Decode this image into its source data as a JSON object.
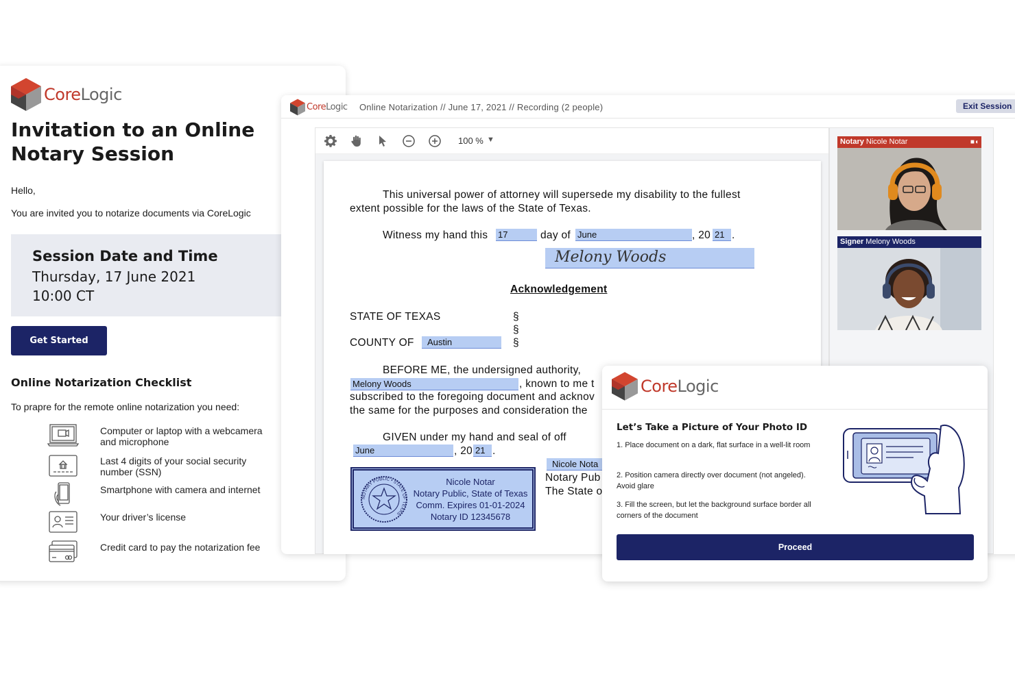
{
  "brand": {
    "name_core": "Core",
    "name_logic": "Logic",
    "trademark": "®",
    "colors": {
      "red": "#c0392b",
      "navy": "#1c2466",
      "highlight": "#b7cdf3"
    }
  },
  "email": {
    "title": "Invitation to an Online Notary Session",
    "greeting": "Hello,",
    "intro": "You are invited you to notarize documents via CoreLogic",
    "session_heading": "Session Date and Time",
    "session_date": "Thursday, 17 June 2021",
    "session_time": "10:00 CT",
    "get_started_label": "Get Started",
    "checklist_heading": "Online Notarization Checklist",
    "checklist_intro": "To prapre for the remote online notarization you need:",
    "checklist": [
      {
        "icon": "computer-icon",
        "text": "Computer or laptop with a webcamera and microphone"
      },
      {
        "icon": "ssn-card-icon",
        "text": "Last 4 digits of your social security number (SSN)"
      },
      {
        "icon": "smartphone-icon",
        "text": "Smartphone with camera and internet"
      },
      {
        "icon": "drivers-license-icon",
        "text": "Your driver’s license"
      },
      {
        "icon": "credit-card-icon",
        "text": "Credit card to pay the notarization fee"
      }
    ]
  },
  "session": {
    "breadcrumb": "Online Notarization // June 17, 2021 // Recording (2 people)",
    "exit_label": "Exit Session",
    "toolbar": {
      "icons": [
        "gear-icon",
        "hand-pan-icon",
        "pointer-icon",
        "zoom-out-icon",
        "zoom-in-icon"
      ],
      "zoom": "100 %"
    },
    "document": {
      "para1_line1": "This universal power of attorney will supersede my disability to the fullest",
      "para1_line2": "extent possible for the laws of the State of Texas.",
      "witness_prefix": "Witness my hand this",
      "witness_day": "17",
      "witness_mid": "day of",
      "witness_month": "June",
      "witness_year_prefix": ", 20",
      "witness_year": "21",
      "witness_end": ".",
      "signature": "Melony Woods",
      "ack_heading": "Acknowledgement",
      "state_label": "STATE OF TEXAS",
      "county_label": "COUNTY OF",
      "county_value": "Austin",
      "section_mark": "§",
      "before_line": "BEFORE ME, the undersigned authority,",
      "signer_name": "Melony Woods",
      "known_to_me": ", known to me t",
      "subscribed_line": "subscribed to the foregoing document and acknov",
      "same_line": "the same for the purposes and consideration the",
      "given_line": "GIVEN   under   my   hand   and   seal   of   off",
      "given_month": "June",
      "given_year_prefix": ", 20",
      "given_year": "21",
      "given_end": ".",
      "notary_name_field": "Nicole Nota",
      "notary_pub_line": "Notary Pub",
      "state_of_line": "The State o",
      "seal": {
        "name": "Nicole Notar",
        "title": "Notary Public, State of Texas",
        "expires": "Comm. Expires 01-01-2024",
        "id": "Notary ID 12345678",
        "ring_text": "NOTARY PUBLIC • STATE OF TEXAS"
      }
    },
    "videos": [
      {
        "role": "Notary",
        "name": "Nicole Notar",
        "color": "#c0392b"
      },
      {
        "role": "Signer",
        "name": "Melony Woods",
        "color": "#1c2466"
      }
    ]
  },
  "modal": {
    "title": "Let’s Take a Picture of Your Photo ID",
    "steps": [
      "1. Place document on a dark, flat surface in a well-lit room",
      "2. Position camera directly over document (not angeled). Avoid glare",
      "3. Fill the screen, but let the background surface border all corners of the document"
    ],
    "proceed_label": "Proceed"
  }
}
